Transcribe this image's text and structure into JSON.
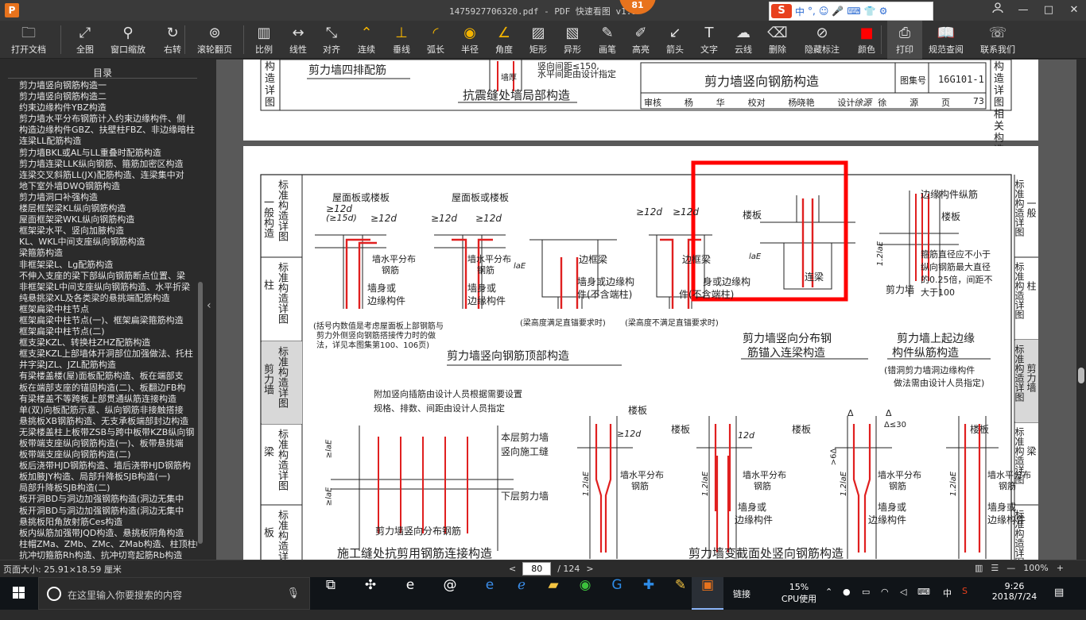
{
  "window": {
    "title": "1475927706320.pdf - PDF 快速看图 v1.9",
    "app_logo": "P",
    "badge": "81",
    "controls": {
      "minimize": "—",
      "maximize": "□",
      "close": "✕"
    },
    "user_icon": "user-icon"
  },
  "ime": {
    "logo": "S",
    "items": [
      "中",
      "°,",
      "☺",
      "🎤",
      "⌨",
      "👕",
      "⚙"
    ]
  },
  "toolbar": [
    {
      "id": "open",
      "label": "打开文档",
      "icon": "folder-icon",
      "glyph": "🗀"
    },
    {
      "id": "fit",
      "label": "全图",
      "icon": "fullscreen-icon",
      "glyph": "⤢"
    },
    {
      "id": "window-zoom",
      "label": "窗口缩放",
      "icon": "magnifier-icon",
      "glyph": "⚲"
    },
    {
      "id": "rotate",
      "label": "右转",
      "icon": "rotate-icon",
      "glyph": "↻"
    },
    {
      "id": "scroll-page",
      "label": "滚轮翻页",
      "icon": "mouse-icon",
      "glyph": "⊚"
    },
    {
      "id": "scale",
      "label": "比例",
      "icon": "ruler-icon",
      "glyph": "▥"
    },
    {
      "id": "linear",
      "label": "线性",
      "icon": "linear-icon",
      "glyph": "↔"
    },
    {
      "id": "aligned",
      "label": "对齐",
      "icon": "aligned-icon",
      "glyph": "⤡"
    },
    {
      "id": "continuous",
      "label": "连续",
      "icon": "continuous-icon",
      "glyph": "⌃"
    },
    {
      "id": "perpendicular",
      "label": "垂线",
      "icon": "perpendicular-icon",
      "glyph": "⊥"
    },
    {
      "id": "arc",
      "label": "弧长",
      "icon": "arc-icon",
      "glyph": "◜"
    },
    {
      "id": "radius",
      "label": "半径",
      "icon": "radius-icon",
      "glyph": "◉"
    },
    {
      "id": "angle",
      "label": "角度",
      "icon": "angle-icon",
      "glyph": "∠"
    },
    {
      "id": "rect",
      "label": "矩形",
      "icon": "rectangle-icon",
      "glyph": "▨"
    },
    {
      "id": "special",
      "label": "异形",
      "icon": "polygon-icon",
      "glyph": "▧"
    },
    {
      "id": "pen",
      "label": "画笔",
      "icon": "pen-icon",
      "glyph": "✎"
    },
    {
      "id": "highlight",
      "label": "高亮",
      "icon": "highlighter-icon",
      "glyph": "✐"
    },
    {
      "id": "arrow",
      "label": "箭头",
      "icon": "arrow-icon",
      "glyph": "↙"
    },
    {
      "id": "text",
      "label": "文字",
      "icon": "text-icon",
      "glyph": "T"
    },
    {
      "id": "cloud",
      "label": "云线",
      "icon": "cloud-icon",
      "glyph": "☁"
    },
    {
      "id": "erase",
      "label": "删除",
      "icon": "eraser-icon",
      "glyph": "⌫"
    },
    {
      "id": "hide",
      "label": "隐藏标注",
      "icon": "eye-slash-icon",
      "glyph": "⊘"
    },
    {
      "id": "color",
      "label": "颜色",
      "icon": "color-swatch-icon",
      "glyph": "■"
    },
    {
      "id": "print",
      "label": "打印",
      "icon": "printer-icon",
      "glyph": "⎙"
    },
    {
      "id": "spec",
      "label": "规范查阅",
      "icon": "book-icon",
      "glyph": "📖"
    },
    {
      "id": "contact",
      "label": "联系我们",
      "icon": "support-icon",
      "glyph": "☏"
    }
  ],
  "colors": {
    "accent": "#e8731d",
    "annotation_red": "#ff0000",
    "rebar_red": "#e02020",
    "color_swatch": "#ff0000"
  },
  "sidebar": {
    "title": "目录",
    "items": [
      "剪力墙竖向钢筋构造一",
      "剪力墙竖向钢筋构造二",
      "约束边缘构件YBZ构造",
      "剪力墙水平分布钢筋计入约束边缘构件、侧",
      "构造边缘构件GBZ、扶壁柱FBZ、非边缘暗柱",
      "连梁LL配筋构造",
      "剪力墙BKL或AL与LL重叠时配筋构造",
      "剪力墙连梁LLK纵向钢筋、箍筋加密区构造",
      "连梁交叉斜筋LL(JX)配筋构造、连梁集中对",
      "地下室外墙DWQ钢筋构造",
      "剪力墙洞口补强构造",
      "楼层框架梁KL纵向钢筋构造",
      "屋面框架梁WKL纵向钢筋构造",
      "框架梁水平、竖向加腋构造",
      "KL、WKL中间支座纵向钢筋构造",
      "梁箍筋构造",
      "非框架梁L、Lg配筋构造",
      "不伸入支座的梁下部纵向钢筋断点位置、梁",
      "非框架梁L中间支座纵向钢筋构造、水平折梁",
      "纯悬挑梁XL及各类梁的悬挑端配筋构造",
      "框架扁梁中柱节点",
      "框架扁梁中柱节点(一)、框架扁梁箍筋构造",
      "框架扁梁中柱节点(二)",
      "框支梁KZL、转换柱ZHZ配筋构造",
      "框支梁KZL上部墙体开洞部位加强做法、托柱",
      "井字梁JZL、JZL配筋构造",
      "有梁楼盖楼(屋)面板配筋构造、板在端部支",
      "板在端部支座的锚固构造(二)、板翻边FB构",
      "有梁楼盖不等跨板上部贯通纵筋连接构造",
      "单(双)向板配筋示意、纵向钢筋非接触搭接",
      "悬挑板XB钢筋构造、无支承板端部封边构造",
      "无梁楼盖柱上板带ZSB与跨中板带KZB纵向钢",
      "板带端支座纵向钢筋构造(一)、板带悬挑端",
      "板带端支座纵向钢筋构造(二)",
      "板后浇带HJD钢筋构造、墙后浇带HJD钢筋构",
      "板加腋JY构造、局部升降板SJB构造(一)",
      "局部升降板SJB构造(二)",
      "板开洞BD与洞边加强钢筋构造(洞边无集中",
      "板开洞BD与洞边加强钢筋构造(洞边无集中",
      "悬挑板阳角放射筋Ces构造",
      "板内纵筋加强带JQD构造、悬挑板阴角构造",
      "柱帽ZMa、ZMb、ZMc、ZMab构造、柱顶柱帽",
      "抗冲切箍筋Rh构造、抗冲切弯起筋Rb构造"
    ]
  },
  "prev_page": {
    "left_tab": [
      "构",
      "造",
      "详",
      "图"
    ],
    "labels": {
      "four_rows": "剪力墙四排配筋",
      "seismic_joint": "抗震缝处墙局部构造",
      "horizontal_note": "水平间距由设计指定",
      "vertical_spacing": "竖向间距≤150,",
      "wall_thickness": "墙厚"
    },
    "title_block": {
      "title": "剪力墙竖向钢筋构造",
      "atlas_label": "图集号",
      "atlas_no": "16G101-1",
      "row": [
        "审核",
        "杨",
        "华",
        "校对",
        "杨晓艳",
        "设计",
        "徐",
        "源",
        "页",
        "73"
      ],
      "signature": "徐源"
    },
    "right_tab": [
      "构",
      "造",
      "详",
      "图",
      "相",
      "关",
      "构",
      "造"
    ]
  },
  "page": {
    "left_tabs": [
      {
        "text": "标准构造详图",
        "section": "一般构造",
        "active": false
      },
      {
        "text": "标准构造详图",
        "section": "柱",
        "active": false
      },
      {
        "text": "标准构造详图",
        "section": "剪力墙",
        "active": true
      },
      {
        "text": "标准构造详图",
        "section": "梁",
        "active": false
      },
      {
        "text": "标准构造详图",
        "section": "板",
        "active": false
      }
    ],
    "right_tabs": [
      {
        "text": "标准构造详图",
        "section": "一般",
        "active": false
      },
      {
        "text": "标准构造详图",
        "section": "柱",
        "active": false
      },
      {
        "text": "标准构造详图",
        "section": "剪力墙",
        "active": true
      },
      {
        "text": "标准构造详图",
        "section": "梁",
        "active": false
      },
      {
        "text": "标准构造详图",
        "section": "",
        "active": false
      }
    ],
    "labels": {
      "roof_slab_1": "屋面板或楼板",
      "roof_slab_2": "屋面板或楼板",
      "d12_1": "≥12d",
      "d15_1": "(≥15d)",
      "d12_2": "≥12d",
      "d12_3": "≥12d",
      "d12_4": "≥12d",
      "d12_5": "≥12d",
      "d12_6": "≥12d",
      "horiz_bar_1": "墙水平分布",
      "horiz_bar_1b": "钢筋",
      "horiz_bar_2": "墙水平分布",
      "horiz_bar_2b": "钢筋",
      "wall_body_1": "墙身或",
      "wall_body_1b": "边缘构件",
      "wall_body_2": "墙身或",
      "wall_body_2b": "边缘构件",
      "edge_beam_1": "边框梁",
      "edge_beam_2": "边框梁",
      "edge_or_1": "墙身或边缘构",
      "edge_or_1b": "件(不含端柱)",
      "edge_or_2": "身或边缘构",
      "edge_or_2b": "件(不含端柱)",
      "lae_1": "laE",
      "note_beam_1": "(梁高度满足直锚要求时)",
      "note_beam_2": "(梁高度不满足直锚要求时)",
      "note_paren": "(括号内数值是考虑屋面板上部钢筋与",
      "note_paren_2": "剪力外侧竖向钢筋搭接传力时的做",
      "note_paren_3": "法，详见本图集第100、106页)",
      "caption_top": "剪力墙竖向钢筋顶部构造",
      "slab_hl": "楼板",
      "coupling_beam": "连梁",
      "lae_hl": "laE",
      "caption_anchor_1": "剪力墙竖向分布钢",
      "caption_anchor_2": "筋锚入连梁构造",
      "edge_long": "边缘构件纵筋",
      "slab_right": "楼板",
      "shear_wall": "剪力墙",
      "stirrup_note_1": "箍筋直径应不小于",
      "stirrup_note_2": "纵向钢筋最大直径",
      "stirrup_note_3": "的0.25倍，间距不",
      "stirrup_note_4": "大于100",
      "lae12": "1.2laE",
      "caption_edge_1": "剪力墙上起边缘",
      "caption_edge_2": "构件纵筋构造",
      "caption_edge_note_1": "(错洞剪力墙洞边缘构件",
      "caption_edge_note_2": "做法需由设计人员指定)",
      "add_dowel": "附加竖向插筋由设计人员根据需要设置",
      "spec_note": "规格、排数、间距由设计人员指定",
      "this_wall": "本层剪力墙",
      "vertical_joint": "竖向施工缝",
      "lower_wall": "下层剪力墙",
      "dist_bar": "剪力墙竖向分布钢筋",
      "ge_lae": "≥laE",
      "ge_lae_2": "≥laE",
      "caption_joint": "施工缝处抗剪用钢筋连接构造",
      "slab_a": "楼板",
      "slab_b": "楼板",
      "slab_c": "楼板",
      "slab_d": "楼板",
      "d12_a": "≥12d",
      "d12_b": "12d",
      "horiz_a": "墙水平分布",
      "horiz_a2": "钢筋",
      "horiz_b": "墙水平分布",
      "horiz_b2": "钢筋",
      "horiz_c": "墙水平分布",
      "horiz_c2": "钢筋",
      "horiz_d": "墙水平分布",
      "horiz_d2": "钢筋",
      "body_b": "墙身或",
      "body_b2": "边缘构件",
      "body_c": "墙身或",
      "body_c2": "边缘构件",
      "body_d": "墙身或",
      "body_d2": "边缘构件",
      "delta": "Δ",
      "delta2": "Δ",
      "delta_le30": "Δ≤30",
      "ge6delta": ">6Δ",
      "lae12_a": "1.2laE",
      "lae12_b": "1.2laE",
      "lae12_c": "1.2laE",
      "lae12_d": "1.2laE",
      "caption_section": "剪力墙变截面处竖向钢筋构造"
    }
  },
  "statusbar": {
    "page_size": "页面大小: 25.91×18.59 厘米",
    "prev": "<",
    "current_page": "80",
    "total": "/ 124",
    "next": ">",
    "zoom_minus": "—",
    "zoom": "100%",
    "zoom_plus": "+"
  },
  "taskbar": {
    "search_placeholder": "在这里输入你要搜索的内容",
    "tray_link": "链接",
    "cpu_percent": "15%",
    "cpu_label": "CPU使用",
    "ime_lang": "中",
    "time": "9:26",
    "date": "2018/7/24"
  }
}
